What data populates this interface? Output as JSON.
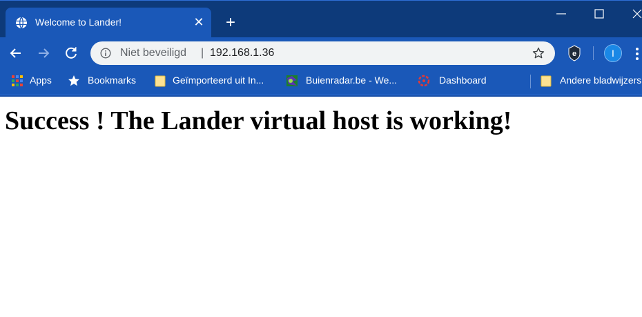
{
  "tab": {
    "title": "Welcome to Lander!",
    "favicon": "globe-icon",
    "close_symbol": "✕"
  },
  "new_tab_symbol": "+",
  "window_controls": [
    "minimize-icon",
    "maximize-icon",
    "close-icon"
  ],
  "omnibox": {
    "security_icon": "info-icon",
    "security_label": "Niet beveiligd",
    "separator": "|",
    "url": "192.168.1.36",
    "bookmark_icon": "star-icon"
  },
  "toolbar": {
    "profile_initial": "I"
  },
  "bookmarks": [
    {
      "label": "Apps",
      "icon": "apps-grid-icon"
    },
    {
      "label": "Bookmarks",
      "icon": "star-icon"
    },
    {
      "label": "Geïmporteerd uit In...",
      "icon": "folder-icon"
    },
    {
      "label": "Buienradar.be - We...",
      "icon": "buienradar-favicon"
    },
    {
      "label": "Dashboard",
      "icon": "dashboard-favicon"
    },
    {
      "label": "Andere bladwijzers",
      "icon": "folder-icon"
    }
  ],
  "page": {
    "heading": "Success ! The Lander virtual host is working!"
  },
  "colors": {
    "tabstrip": "#0d3a7a",
    "toolbar": "#1a58b8",
    "omnibox": "#f1f3f4",
    "profile": "#1a88e6"
  }
}
